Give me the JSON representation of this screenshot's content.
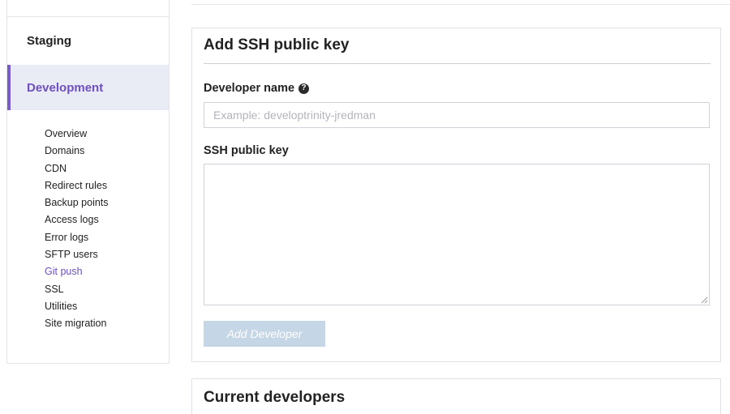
{
  "sidebar": {
    "environments": {
      "staging": "Staging",
      "development": "Development"
    },
    "items": [
      {
        "label": "Overview",
        "active": false
      },
      {
        "label": "Domains",
        "active": false
      },
      {
        "label": "CDN",
        "active": false
      },
      {
        "label": "Redirect rules",
        "active": false
      },
      {
        "label": "Backup points",
        "active": false
      },
      {
        "label": "Access logs",
        "active": false
      },
      {
        "label": "Error logs",
        "active": false
      },
      {
        "label": "SFTP users",
        "active": false
      },
      {
        "label": "Git push",
        "active": true
      },
      {
        "label": "SSL",
        "active": false
      },
      {
        "label": "Utilities",
        "active": false
      },
      {
        "label": "Site migration",
        "active": false
      }
    ]
  },
  "add_key_form": {
    "title": "Add SSH public key",
    "developer_name": {
      "label": "Developer name",
      "help_icon": "question-circle-icon",
      "value": "",
      "placeholder": "Example: developtrinity-jredman"
    },
    "ssh_key": {
      "label": "SSH public key",
      "value": ""
    },
    "submit_label": "Add Developer"
  },
  "current_developers": {
    "title": "Current developers"
  },
  "colors": {
    "accent": "#6e4fc0",
    "active_bg": "#e9ebf5",
    "button_disabled": "#c5d6e6"
  }
}
